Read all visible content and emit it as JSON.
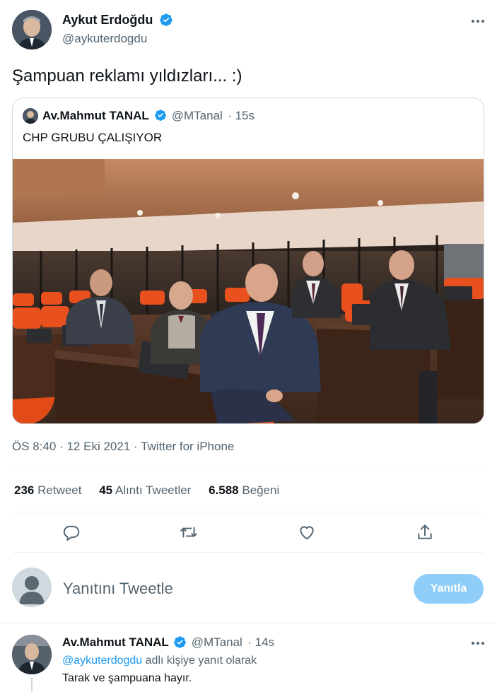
{
  "tweet": {
    "author_name": "Aykut Erdoğdu",
    "author_handle": "@aykuterdogdu",
    "text": "Şampuan reklamı yıldızları... :)",
    "timestamp": "ÖS 8:40 · 12 Eki 2021 · Twitter for iPhone"
  },
  "quoted": {
    "author_name": "Av.Mahmut TANAL",
    "author_handle": "@MTanal",
    "time": "· 15s",
    "text": "CHP GRUBU ÇALIŞIYOR"
  },
  "stats": {
    "retweets_count": "236",
    "retweets_label": "Retweet",
    "quotes_count": "45",
    "quotes_label": "Alıntı Tweetler",
    "likes_count": "6.588",
    "likes_label": "Beğeni"
  },
  "actions": {
    "icons": [
      "reply-icon",
      "retweet-icon",
      "like-icon",
      "share-icon"
    ]
  },
  "reply_box": {
    "placeholder": "Yanıtını Tweetle",
    "button_label": "Yanıtla"
  },
  "reply": {
    "author_name": "Av.Mahmut TANAL",
    "author_handle": "@MTanal",
    "time": "· 14s",
    "mention": "@aykuterdogdu",
    "reply_context": "adlı kişiye yanıt olarak",
    "text": "Tarak ve şampuana hayır."
  },
  "colors": {
    "verified": "#1d9bf0",
    "accent": "#1d9bf0",
    "reply_button_disabled": "#8ecdf8",
    "muted_text": "#536471"
  }
}
